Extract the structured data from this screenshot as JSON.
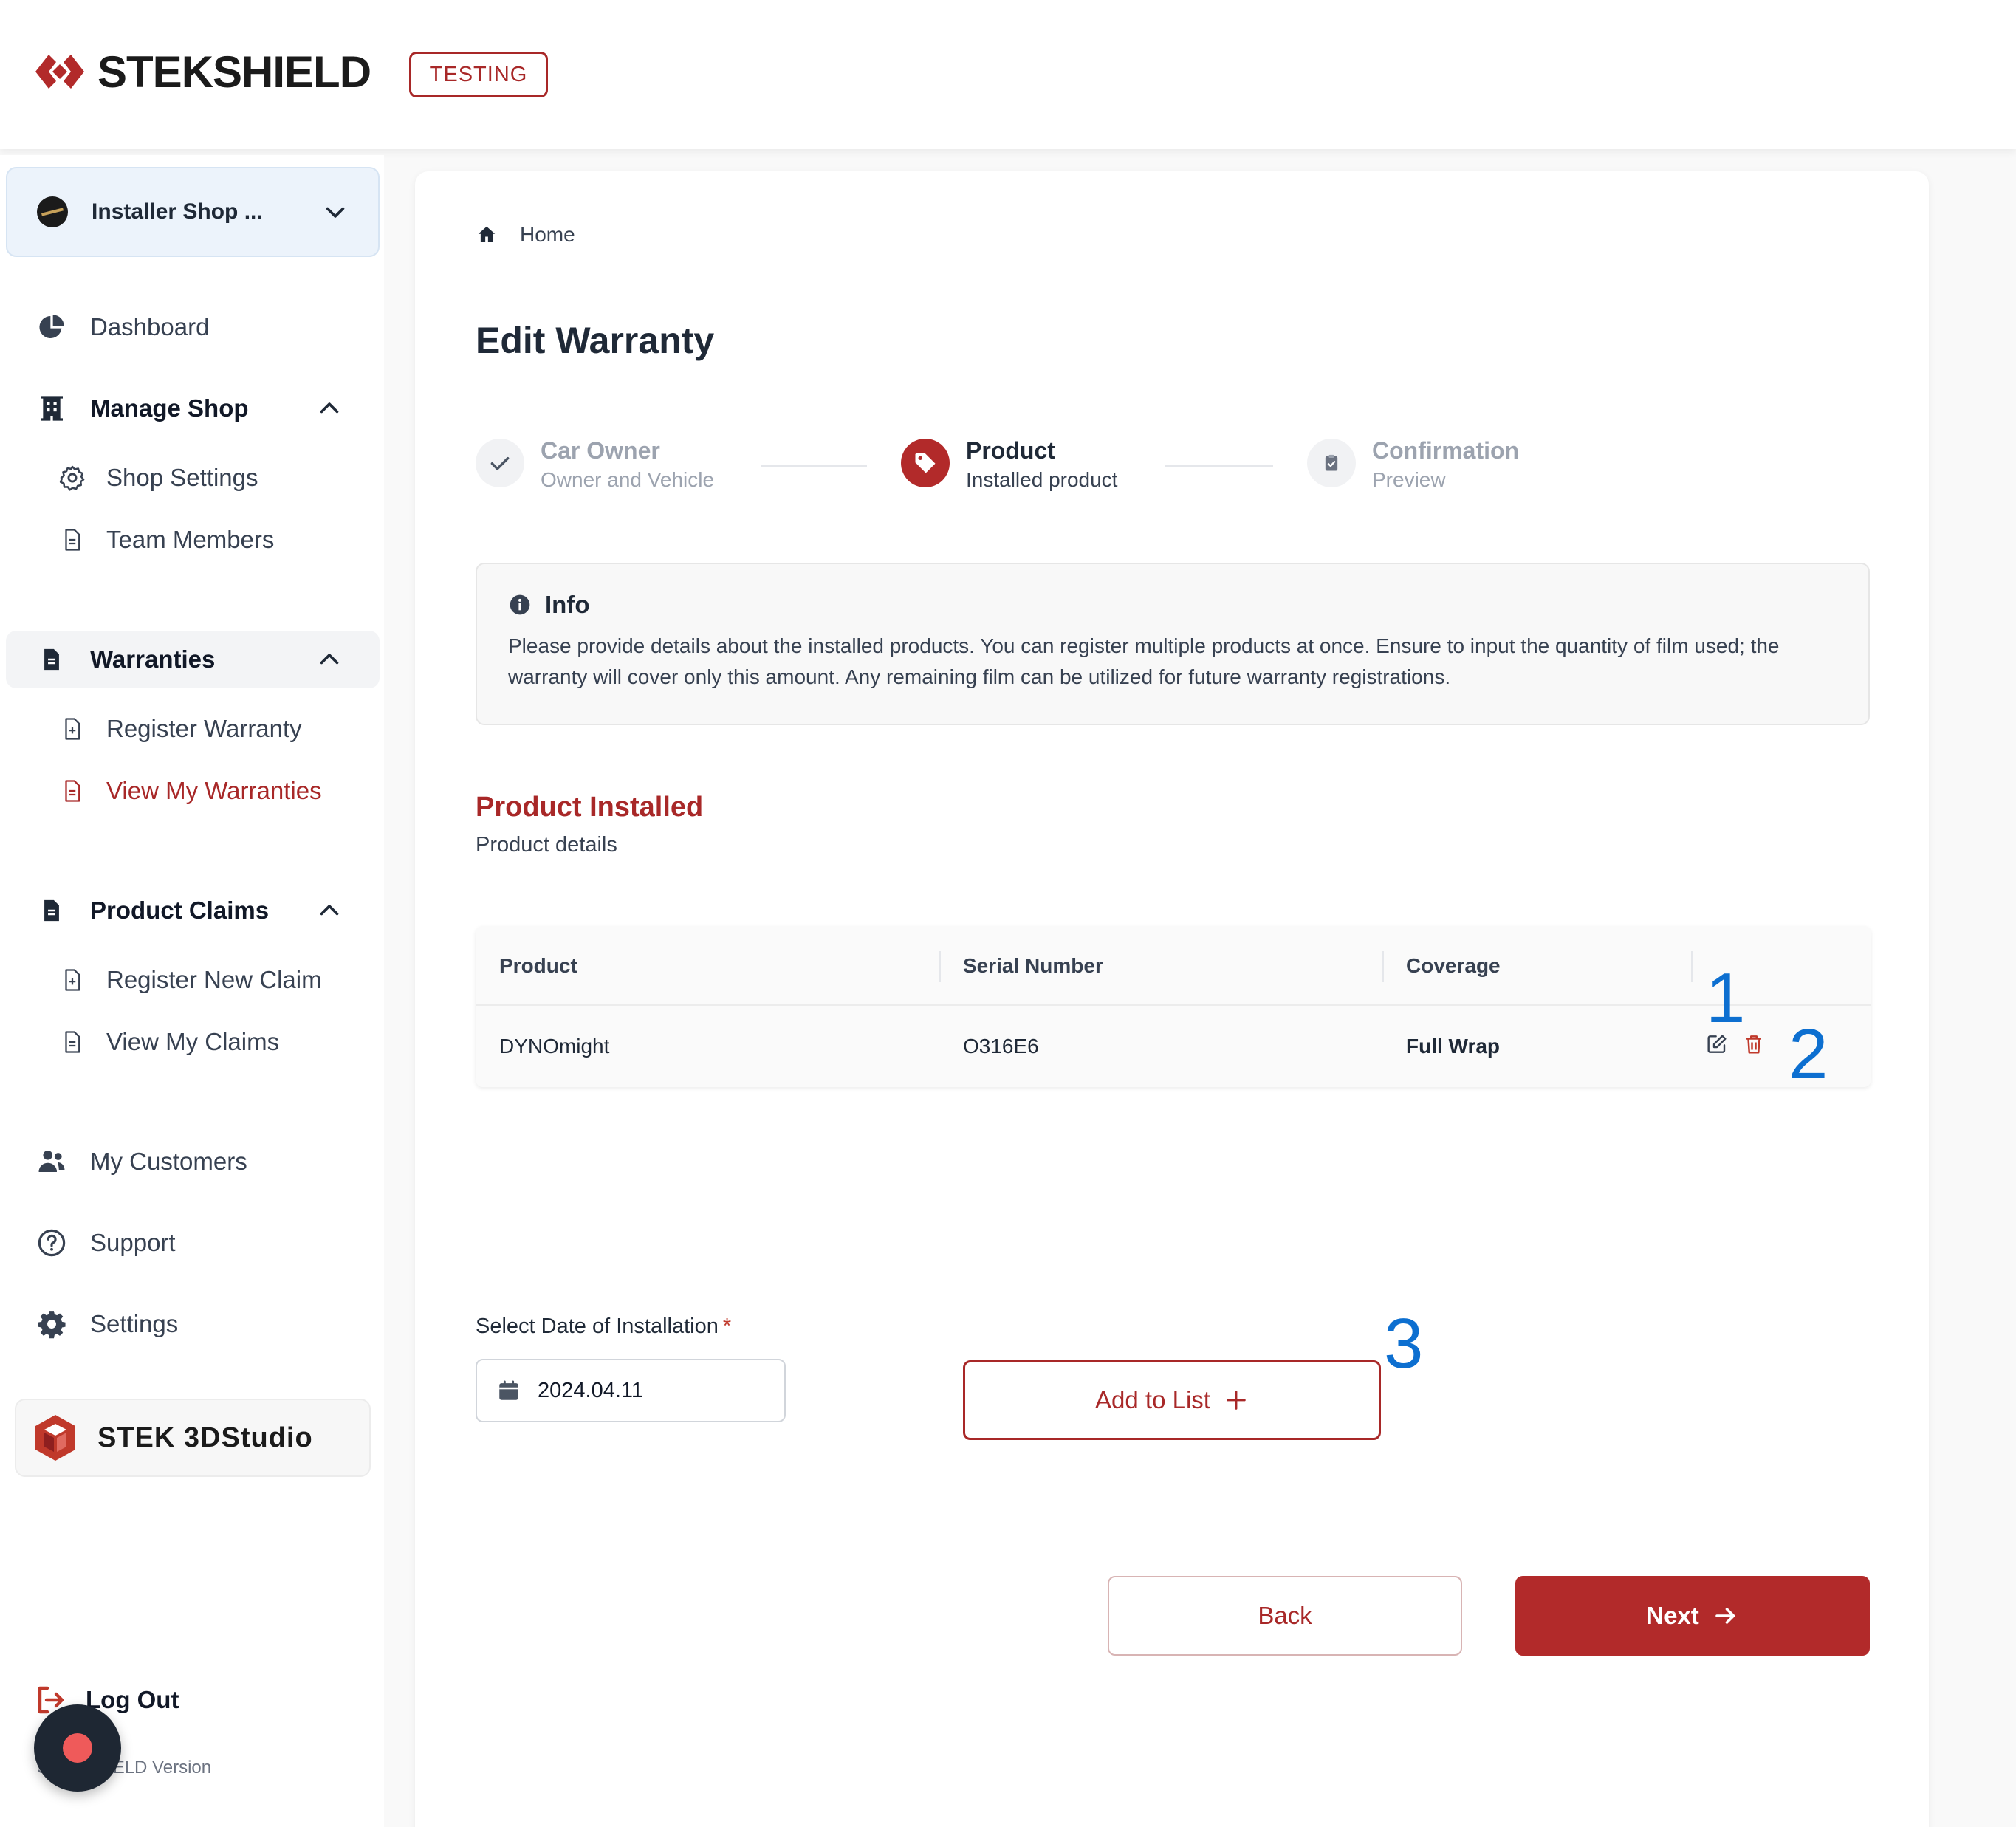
{
  "header": {
    "brand": "STEKSHIELD",
    "env_badge": "TESTING"
  },
  "sidebar": {
    "shop_selector": {
      "label": "Installer Shop ...",
      "icon": "chevron-down-icon"
    },
    "items": [
      {
        "label": "Dashboard",
        "icon": "pie-chart-icon"
      },
      {
        "label": "Manage Shop",
        "icon": "building-icon",
        "expanded": true,
        "children": [
          {
            "label": "Shop Settings",
            "icon": "gear-outline-icon"
          },
          {
            "label": "Team Members",
            "icon": "document-icon"
          }
        ]
      },
      {
        "label": "Warranties",
        "icon": "document-filled-icon",
        "expanded": true,
        "children": [
          {
            "label": "Register Warranty",
            "icon": "document-plus-icon"
          },
          {
            "label": "View My Warranties",
            "icon": "document-icon",
            "active": true
          }
        ]
      },
      {
        "label": "Product Claims",
        "icon": "document-filled-icon",
        "expanded": true,
        "children": [
          {
            "label": "Register New Claim",
            "icon": "document-plus-icon"
          },
          {
            "label": "View My Claims",
            "icon": "document-icon"
          }
        ]
      },
      {
        "label": "My Customers",
        "icon": "users-icon"
      },
      {
        "label": "Support",
        "icon": "question-circle-icon"
      },
      {
        "label": "Settings",
        "icon": "gear-icon"
      }
    ],
    "studio": {
      "label": "STEK 3DStudio"
    },
    "logout": {
      "label": "Log Out"
    },
    "version": "STEKSHIELD Version"
  },
  "main": {
    "breadcrumb": {
      "home": "Home"
    },
    "title": "Edit Warranty",
    "steps": [
      {
        "title": "Car Owner",
        "subtitle": "Owner and Vehicle",
        "state": "done"
      },
      {
        "title": "Product",
        "subtitle": "Installed product",
        "state": "current"
      },
      {
        "title": "Confirmation",
        "subtitle": "Preview",
        "state": "todo"
      }
    ],
    "info": {
      "title": "Info",
      "text": "Please provide details about the installed products. You can register multiple products at once. Ensure to input the quantity of film used; the warranty will cover only this amount. Any remaining film can be utilized for future warranty registrations."
    },
    "section": {
      "title": "Product Installed",
      "subtitle": "Product details"
    },
    "table": {
      "columns": [
        "Product",
        "Serial Number",
        "Coverage"
      ],
      "rows": [
        {
          "product": "DYNOmight",
          "serial": "O316E6",
          "coverage": "Full Wrap"
        }
      ]
    },
    "annotations": [
      "1",
      "2",
      "3"
    ],
    "date": {
      "label": "Select Date of Installation",
      "required_mark": "*",
      "value": "2024.04.11"
    },
    "add_button": "Add to List",
    "back_button": "Back",
    "next_button": "Next"
  },
  "colors": {
    "brand_red": "#b22a2a",
    "accent_text_red": "#a82828",
    "annotation_blue": "#0d6fd0"
  }
}
